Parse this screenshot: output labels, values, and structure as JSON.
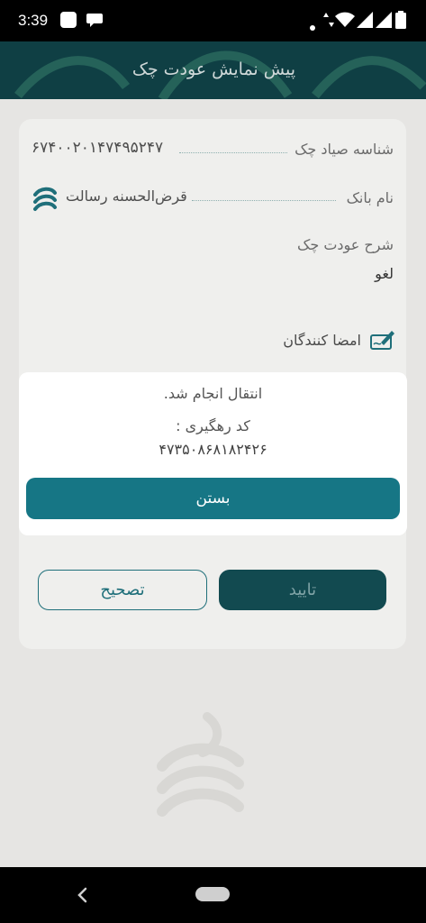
{
  "status_bar": {
    "time": "3:39"
  },
  "app_bar": {
    "title": "پیش نمایش عودت چک"
  },
  "check": {
    "sayad_label": "شناسه صیاد چک",
    "sayad_value": "۶۷۴۰۰۲۰۱۴۷۴۹۵۲۴۷",
    "bank_label": "نام بانک",
    "bank_value": "قرض‌الحسنه رسالت",
    "description_label": "شرح عودت چک",
    "description_value": "لغو",
    "signers_label": "امضا کنندگان"
  },
  "actions": {
    "confirm_label": "تایید",
    "edit_label": "تصحیح"
  },
  "dialog": {
    "message": "انتقال انجام شد.",
    "tracking_label": "کد رهگیری :",
    "tracking_code": "۴۷۳۵۰۸۶۸۱۸۲۴۲۶",
    "close_label": "بستن"
  },
  "colors": {
    "primary": "#167685",
    "app_bar": "#0f3f44",
    "confirm_button": "#0f3f44"
  }
}
